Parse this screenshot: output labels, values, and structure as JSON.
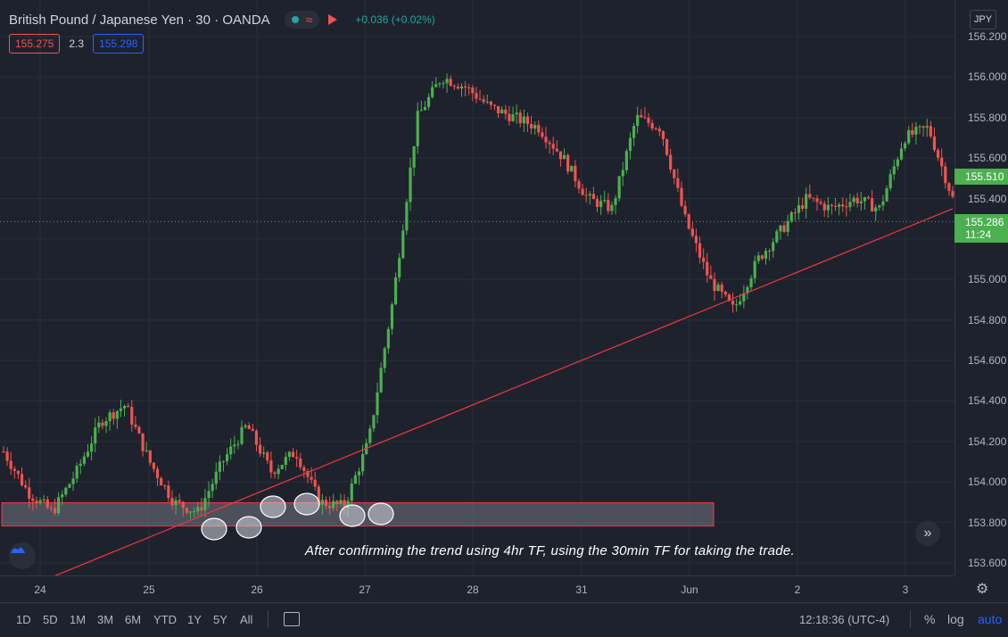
{
  "header": {
    "symbol_title": "British Pound / Japanese Yen · 30 · OANDA",
    "change_text": "+0.036 (+0.02%)",
    "currency": "JPY",
    "bid": "155.275",
    "spread": "2.3",
    "ask": "155.298"
  },
  "price_axis": {
    "ticks": [
      "156.200",
      "156.000",
      "155.800",
      "155.600",
      "155.400",
      "155.200",
      "155.000",
      "154.800",
      "154.600",
      "154.400",
      "154.200",
      "154.000",
      "153.800",
      "153.600"
    ],
    "tag_last": "155.510",
    "tag_current": "155.286",
    "tag_countdown": "11:24"
  },
  "time_axis": {
    "labels": [
      "24",
      "25",
      "26",
      "27",
      "28",
      "31",
      "Jun",
      "2",
      "3"
    ]
  },
  "annotation": "After confirming the trend using 4hr TF, using the 30min TF for taking the trade.",
  "bottom_bar": {
    "ranges": [
      "1D",
      "5D",
      "1M",
      "3M",
      "6M",
      "YTD",
      "1Y",
      "5Y",
      "All"
    ],
    "clock": "12:18:36 (UTC-4)",
    "percent_label": "%",
    "log_label": "log",
    "auto_label": "auto"
  },
  "colors": {
    "up": "#4caf50",
    "down": "#ef5350",
    "trendline": "#f23645",
    "zone_fill": "#5d606b",
    "background": "#1e222d",
    "accent_blue": "#2962ff"
  },
  "icons": {
    "status": "market-open-dot",
    "replay": "wave-icon",
    "flag": "flag-icon",
    "logo": "tradingview-logo",
    "scroll": "double-chevron-right-icon",
    "settings": "gear-icon",
    "compare": "date-range-icon"
  },
  "chart_data": {
    "type": "candlestick",
    "y_range": [
      153.55,
      156.25
    ],
    "path_points": [
      [
        "24",
        154.15
      ],
      [
        "24",
        153.95
      ],
      [
        "24",
        153.85
      ],
      [
        "25",
        154.05
      ],
      [
        "25",
        154.3
      ],
      [
        "25",
        154.38
      ],
      [
        "25",
        154.1
      ],
      [
        "25",
        153.9
      ],
      [
        "26",
        153.85
      ],
      [
        "26",
        154.1
      ],
      [
        "26",
        154.28
      ],
      [
        "26",
        154.05
      ],
      [
        "26",
        154.15
      ],
      [
        "27",
        153.9
      ],
      [
        "27",
        153.88
      ],
      [
        "27",
        154.2
      ],
      [
        "27",
        154.9
      ],
      [
        "27",
        155.8
      ],
      [
        "28",
        156.0
      ],
      [
        "28",
        155.95
      ],
      [
        "28",
        155.85
      ],
      [
        "28",
        155.8
      ],
      [
        "31",
        155.75
      ],
      [
        "31",
        155.6
      ],
      [
        "31",
        155.4
      ],
      [
        "31",
        155.35
      ],
      [
        "Jun",
        155.8
      ],
      [
        "Jun",
        155.75
      ],
      [
        "Jun",
        155.3
      ],
      [
        "Jun",
        155.0
      ],
      [
        "2",
        154.85
      ],
      [
        "2",
        155.1
      ],
      [
        "2",
        155.25
      ],
      [
        "2",
        155.4
      ],
      [
        "2",
        155.35
      ],
      [
        "3",
        155.4
      ],
      [
        "3",
        155.35
      ],
      [
        "3",
        155.7
      ],
      [
        "3",
        155.75
      ],
      [
        "3",
        155.4
      ]
    ],
    "support_zone": [
      153.8,
      153.88
    ],
    "trendline": [
      [
        "24",
        153.55
      ],
      [
        "3",
        155.35
      ]
    ]
  }
}
